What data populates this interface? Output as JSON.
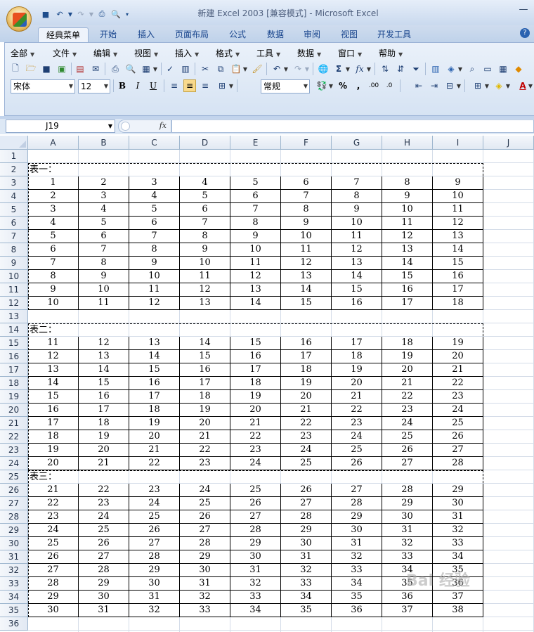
{
  "window": {
    "title": "新建 Excel 2003  [兼容模式] - Microsoft Excel"
  },
  "ribbon_tabs": [
    "经典菜单",
    "开始",
    "插入",
    "页面布局",
    "公式",
    "数据",
    "审阅",
    "视图",
    "开发工具"
  ],
  "classic_menu": [
    "全部",
    "文件",
    "编辑",
    "视图",
    "插入",
    "格式",
    "工具",
    "数据",
    "窗口",
    "帮助"
  ],
  "font": {
    "name": "宋体",
    "size": "12"
  },
  "number_format": "常规",
  "name_box": "J19",
  "fx_label": "fx",
  "columns": [
    "A",
    "B",
    "C",
    "D",
    "E",
    "F",
    "G",
    "H",
    "I",
    "J"
  ],
  "rows": [
    "1",
    "2",
    "3",
    "4",
    "5",
    "6",
    "7",
    "8",
    "9",
    "10",
    "11",
    "12",
    "13",
    "14",
    "15",
    "16",
    "17",
    "18",
    "19",
    "20",
    "21",
    "22",
    "23",
    "24",
    "25",
    "26",
    "27",
    "28",
    "29",
    "30",
    "31",
    "32",
    "33",
    "34",
    "35",
    "36"
  ],
  "tables": [
    {
      "label": "表一：",
      "start": 1
    },
    {
      "label": "表二：",
      "start": 11
    },
    {
      "label": "表三：",
      "start": 21
    }
  ],
  "watermark": "Bai 经验",
  "colors": {
    "ribbon_bg": "#dbe6f4",
    "header_bg": "#e2e9f3",
    "grid_line": "#d4dce8",
    "tab_text": "#15428b"
  },
  "icons": [
    "new-icon",
    "open-icon",
    "save-icon",
    "print-icon",
    "preview-icon",
    "spell-icon",
    "cut-icon",
    "copy-icon",
    "paste-icon",
    "format-painter-icon",
    "undo-icon",
    "redo-icon",
    "sum-icon",
    "function-icon",
    "sort-asc-icon",
    "sort-desc-icon",
    "filter-icon",
    "chart-icon",
    "bold-icon",
    "italic-icon",
    "underline-icon",
    "align-left-icon",
    "align-center-icon",
    "align-right-icon",
    "merge-icon",
    "currency-icon",
    "percent-icon",
    "comma-icon",
    "increase-decimal-icon",
    "decrease-decimal-icon",
    "border-icon",
    "fill-color-icon",
    "font-color-icon"
  ]
}
